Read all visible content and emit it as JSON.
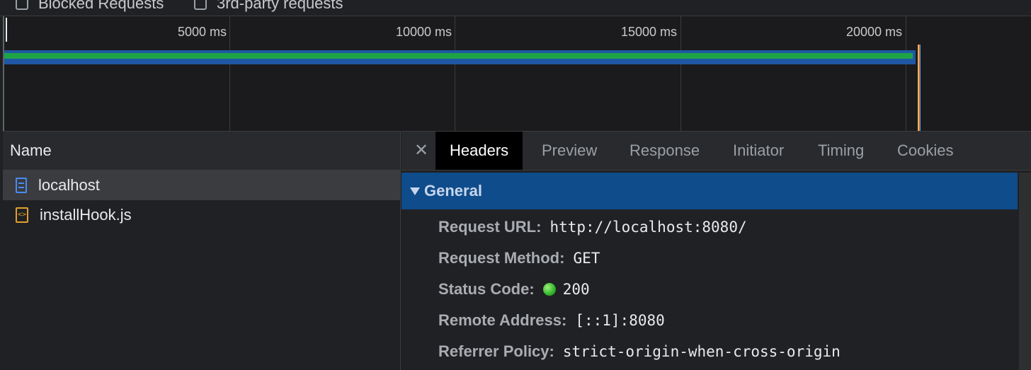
{
  "filters": {
    "blocked_requests": "Blocked Requests",
    "third_party": "3rd-party requests"
  },
  "timeline": {
    "ticks": [
      "5000 ms",
      "10000 ms",
      "15000 ms",
      "20000 ms"
    ]
  },
  "name_panel": {
    "header": "Name",
    "requests": [
      {
        "name": "localhost",
        "icon": "document-icon",
        "selected": true
      },
      {
        "name": "installHook.js",
        "icon": "script-icon",
        "selected": false
      }
    ]
  },
  "details": {
    "close_icon": "close-icon",
    "tabs": [
      "Headers",
      "Preview",
      "Response",
      "Initiator",
      "Timing",
      "Cookies"
    ],
    "active_tab": "Headers",
    "section_title": "General",
    "fields": [
      {
        "key": "Request URL:",
        "value": "http://localhost:8080/"
      },
      {
        "key": "Request Method:",
        "value": "GET"
      },
      {
        "key": "Status Code:",
        "value": "200",
        "status_color": "#2fb52a"
      },
      {
        "key": "Remote Address:",
        "value": "[::1]:8080"
      },
      {
        "key": "Referrer Policy:",
        "value": "strict-origin-when-cross-origin"
      }
    ]
  },
  "colors": {
    "selected_section": "#0f4c8b",
    "waterfall_blue": "#1f57a4",
    "waterfall_green": "#1ea446"
  }
}
